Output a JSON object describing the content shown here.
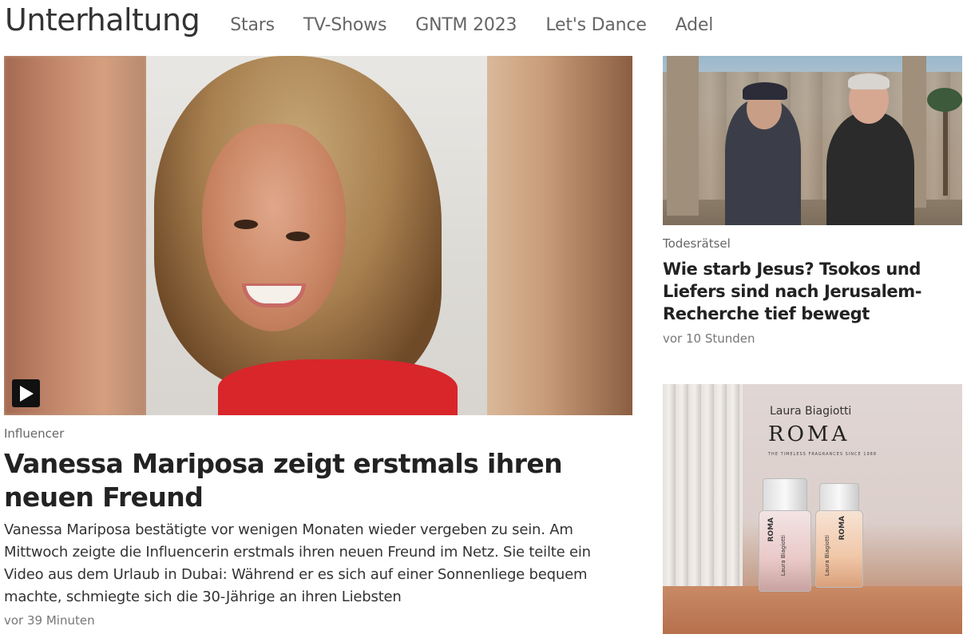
{
  "header": {
    "section_title": "Unterhaltung",
    "nav": [
      {
        "label": "Stars"
      },
      {
        "label": "TV-Shows"
      },
      {
        "label": "GNTM 2023"
      },
      {
        "label": "Let's Dance"
      },
      {
        "label": "Adel"
      }
    ]
  },
  "lead_article": {
    "kicker": "Influencer",
    "title": "Vanessa Mariposa zeigt erstmals ihren neuen Freund",
    "teaser": "Vanessa Mariposa bestätigte vor wenigen Monaten wieder vergeben zu sein. Am Mittwoch zeigte die Influencerin erstmals ihren neuen Freund im Netz. Sie teilte ein Video aus dem Urlaub in Dubai: Während er es sich auf einer Sonnenliege bequem machte, schmiegte sich die 30-Jährige an ihren Liebsten",
    "time": "vor 39 Minuten",
    "media_icon": "play-icon"
  },
  "side_article": {
    "kicker": "Todesrätsel",
    "title": "Wie starb Jesus? Tsokos und Liefers sind nach Jerusalem-Recherche tief bewegt",
    "time": "vor 10 Stunden"
  },
  "ad": {
    "brand_small": "Laura Biagiotti",
    "brand_big": "ROMA",
    "tagline": "THE TIMELESS FRAGRANCES SINCE 1988",
    "bottle_label": "ROMA",
    "bottle_sub": "Laura Biagiotti"
  },
  "colors": {
    "text": "#222222",
    "muted": "#666666",
    "nav": "#666666",
    "accent_red": "#d8262b"
  }
}
